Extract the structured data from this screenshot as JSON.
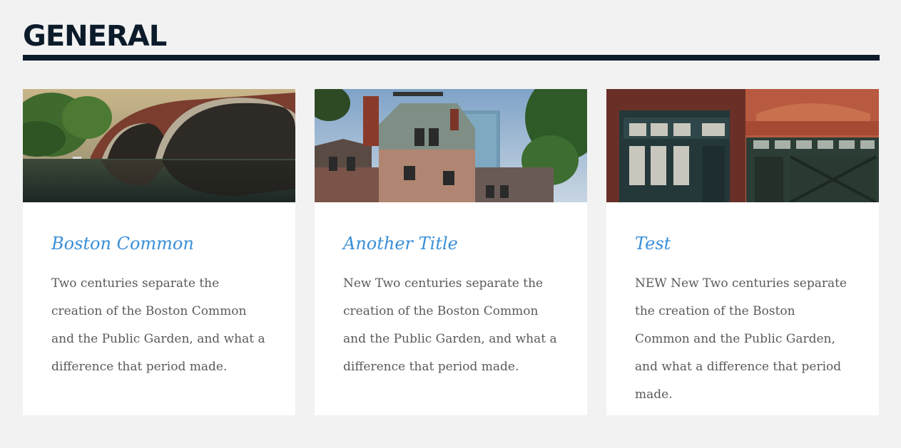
{
  "section": {
    "title": "GENERAL"
  },
  "cards": [
    {
      "image": "bridge-over-river-photo",
      "title": "Boston Common",
      "text": "Two centuries separate the creation of the Boston Common and the Public Garden, and what a difference that period made."
    },
    {
      "image": "brownstone-buildings-photo",
      "title": "Another Title",
      "text": "New Two centuries separate the creation of the Boston Common and the Public Garden, and what a difference that period made."
    },
    {
      "image": "brick-storefront-doors-photo",
      "title": "Test",
      "text": "NEW New Two centuries separate the creation of the Boston Common and the Public Garden, and what a difference that period made."
    }
  ],
  "colors": {
    "heading": "#0c1b2a",
    "card_title": "#3a8fd8",
    "body_text": "#5a5a5a",
    "page_bg": "#f2f2f2"
  }
}
